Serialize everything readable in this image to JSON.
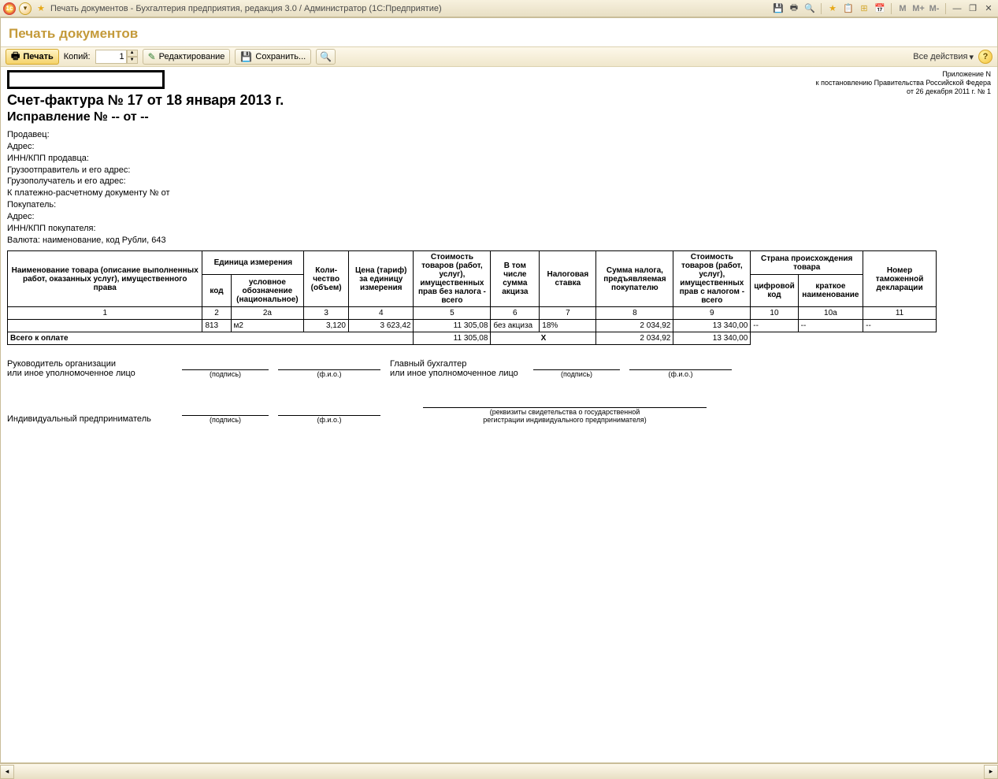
{
  "titlebar": {
    "app_title": "Печать документов - Бухгалтерия предприятия, редакция 3.0 / Администратор  (1С:Предприятие)",
    "m_plain": "M",
    "m_plus": "M+",
    "m_minus": "M-"
  },
  "page": {
    "title": "Печать документов"
  },
  "toolbar": {
    "print_label": "Печать",
    "copies_label": "Копий:",
    "copies_value": "1",
    "edit_label": "Редактирование",
    "save_label": "Сохранить...",
    "all_actions_label": "Все действия"
  },
  "annex": {
    "line1": "Приложение N",
    "line2": "к постановлению Правительства Российской Федера",
    "line3": "от 26 декабря 2011 г. № 1"
  },
  "doc": {
    "title": "Счет-фактура № 17 от 18 января 2013 г.",
    "subtitle": "Исправление № -- от --",
    "seller": "Продавец:",
    "addr": "Адрес:",
    "inn_seller": "ИНН/КПП продавца:",
    "consignor": "Грузоотправитель и его адрес:",
    "consignee": "Грузополучатель и его адрес:",
    "payment_doc": "К платежно-расчетному документу №     от",
    "buyer": "Покупатель:",
    "addr2": "Адрес:",
    "inn_buyer": "ИНН/КПП покупателя:",
    "currency": "Валюта: наименование, код Рубли, 643"
  },
  "table": {
    "h1": "Наименование товара (описание выполненных работ, оказанных услуг), имущественного права",
    "h2": "Единица измерения",
    "h2a": "код",
    "h2b": "условное обозначение (национальное)",
    "h3": "Коли-чество (объем)",
    "h4": "Цена (тариф) за единицу измерения",
    "h5": "Стоимость товаров (работ, услуг), имущественных прав без налога - всего",
    "h6": "В том числе сумма акциза",
    "h7": "Налоговая ставка",
    "h8": "Сумма налога, предъявляемая покупателю",
    "h9": "Стоимость товаров (работ, услуг), имущественных прав с налогом - всего",
    "h10": "Страна происхождения товара",
    "h10a": "цифровой код",
    "h10b": "краткое наименование",
    "h11": "Номер таможенной декларации",
    "n1": "1",
    "n2": "2",
    "n2a": "2а",
    "n3": "3",
    "n4": "4",
    "n5": "5",
    "n6": "6",
    "n7": "7",
    "n8": "8",
    "n9": "9",
    "n10": "10",
    "n10a": "10а",
    "n11": "11",
    "row": {
      "name": "",
      "code": "813",
      "unit": "м2",
      "qty": "3,120",
      "price": "3 623,42",
      "sum_no_tax": "11 305,08",
      "excise": "без акциза",
      "rate": "18%",
      "tax": "2 034,92",
      "sum_with_tax": "13 340,00",
      "country_code": "--",
      "country_name": "--",
      "decl": "--"
    },
    "total_label": "Всего к оплате",
    "total_sum_no_tax": "11 305,08",
    "total_cross": "Х",
    "total_tax": "2 034,92",
    "total_sum_with_tax": "13 340,00"
  },
  "sign": {
    "head": "Руководитель организации",
    "head2": "или иное уполномоченное лицо",
    "chief_acc": "Главный бухгалтер",
    "chief_acc2": "или иное уполномоченное лицо",
    "signature": "(подпись)",
    "fio": "(ф.и.о.)",
    "ip": "Индивидуальный предприниматель",
    "ip_note1": "(реквизиты свидетельства о государственной",
    "ip_note2": "регистрации индивидуального предпринимателя)"
  }
}
